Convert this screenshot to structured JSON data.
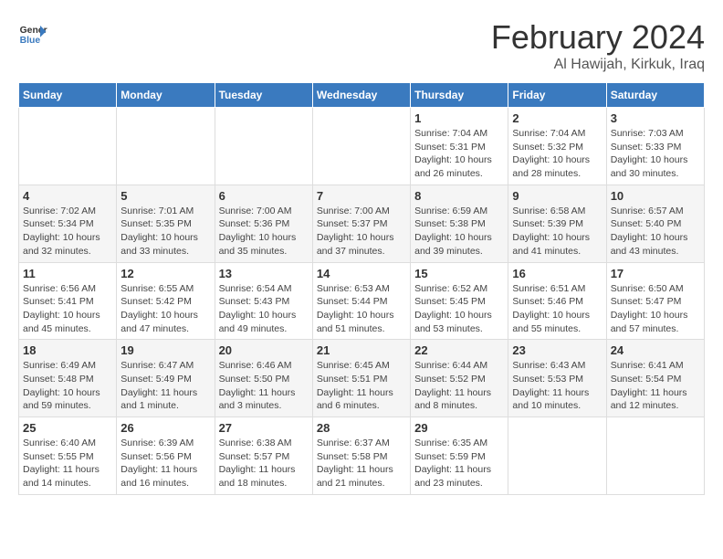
{
  "header": {
    "logo_line1": "General",
    "logo_line2": "Blue",
    "month_year": "February 2024",
    "location": "Al Hawijah, Kirkuk, Iraq"
  },
  "weekdays": [
    "Sunday",
    "Monday",
    "Tuesday",
    "Wednesday",
    "Thursday",
    "Friday",
    "Saturday"
  ],
  "weeks": [
    [
      {
        "day": "",
        "info": ""
      },
      {
        "day": "",
        "info": ""
      },
      {
        "day": "",
        "info": ""
      },
      {
        "day": "",
        "info": ""
      },
      {
        "day": "1",
        "info": "Sunrise: 7:04 AM\nSunset: 5:31 PM\nDaylight: 10 hours and 26 minutes."
      },
      {
        "day": "2",
        "info": "Sunrise: 7:04 AM\nSunset: 5:32 PM\nDaylight: 10 hours and 28 minutes."
      },
      {
        "day": "3",
        "info": "Sunrise: 7:03 AM\nSunset: 5:33 PM\nDaylight: 10 hours and 30 minutes."
      }
    ],
    [
      {
        "day": "4",
        "info": "Sunrise: 7:02 AM\nSunset: 5:34 PM\nDaylight: 10 hours and 32 minutes."
      },
      {
        "day": "5",
        "info": "Sunrise: 7:01 AM\nSunset: 5:35 PM\nDaylight: 10 hours and 33 minutes."
      },
      {
        "day": "6",
        "info": "Sunrise: 7:00 AM\nSunset: 5:36 PM\nDaylight: 10 hours and 35 minutes."
      },
      {
        "day": "7",
        "info": "Sunrise: 7:00 AM\nSunset: 5:37 PM\nDaylight: 10 hours and 37 minutes."
      },
      {
        "day": "8",
        "info": "Sunrise: 6:59 AM\nSunset: 5:38 PM\nDaylight: 10 hours and 39 minutes."
      },
      {
        "day": "9",
        "info": "Sunrise: 6:58 AM\nSunset: 5:39 PM\nDaylight: 10 hours and 41 minutes."
      },
      {
        "day": "10",
        "info": "Sunrise: 6:57 AM\nSunset: 5:40 PM\nDaylight: 10 hours and 43 minutes."
      }
    ],
    [
      {
        "day": "11",
        "info": "Sunrise: 6:56 AM\nSunset: 5:41 PM\nDaylight: 10 hours and 45 minutes."
      },
      {
        "day": "12",
        "info": "Sunrise: 6:55 AM\nSunset: 5:42 PM\nDaylight: 10 hours and 47 minutes."
      },
      {
        "day": "13",
        "info": "Sunrise: 6:54 AM\nSunset: 5:43 PM\nDaylight: 10 hours and 49 minutes."
      },
      {
        "day": "14",
        "info": "Sunrise: 6:53 AM\nSunset: 5:44 PM\nDaylight: 10 hours and 51 minutes."
      },
      {
        "day": "15",
        "info": "Sunrise: 6:52 AM\nSunset: 5:45 PM\nDaylight: 10 hours and 53 minutes."
      },
      {
        "day": "16",
        "info": "Sunrise: 6:51 AM\nSunset: 5:46 PM\nDaylight: 10 hours and 55 minutes."
      },
      {
        "day": "17",
        "info": "Sunrise: 6:50 AM\nSunset: 5:47 PM\nDaylight: 10 hours and 57 minutes."
      }
    ],
    [
      {
        "day": "18",
        "info": "Sunrise: 6:49 AM\nSunset: 5:48 PM\nDaylight: 10 hours and 59 minutes."
      },
      {
        "day": "19",
        "info": "Sunrise: 6:47 AM\nSunset: 5:49 PM\nDaylight: 11 hours and 1 minute."
      },
      {
        "day": "20",
        "info": "Sunrise: 6:46 AM\nSunset: 5:50 PM\nDaylight: 11 hours and 3 minutes."
      },
      {
        "day": "21",
        "info": "Sunrise: 6:45 AM\nSunset: 5:51 PM\nDaylight: 11 hours and 6 minutes."
      },
      {
        "day": "22",
        "info": "Sunrise: 6:44 AM\nSunset: 5:52 PM\nDaylight: 11 hours and 8 minutes."
      },
      {
        "day": "23",
        "info": "Sunrise: 6:43 AM\nSunset: 5:53 PM\nDaylight: 11 hours and 10 minutes."
      },
      {
        "day": "24",
        "info": "Sunrise: 6:41 AM\nSunset: 5:54 PM\nDaylight: 11 hours and 12 minutes."
      }
    ],
    [
      {
        "day": "25",
        "info": "Sunrise: 6:40 AM\nSunset: 5:55 PM\nDaylight: 11 hours and 14 minutes."
      },
      {
        "day": "26",
        "info": "Sunrise: 6:39 AM\nSunset: 5:56 PM\nDaylight: 11 hours and 16 minutes."
      },
      {
        "day": "27",
        "info": "Sunrise: 6:38 AM\nSunset: 5:57 PM\nDaylight: 11 hours and 18 minutes."
      },
      {
        "day": "28",
        "info": "Sunrise: 6:37 AM\nSunset: 5:58 PM\nDaylight: 11 hours and 21 minutes."
      },
      {
        "day": "29",
        "info": "Sunrise: 6:35 AM\nSunset: 5:59 PM\nDaylight: 11 hours and 23 minutes."
      },
      {
        "day": "",
        "info": ""
      },
      {
        "day": "",
        "info": ""
      }
    ]
  ]
}
